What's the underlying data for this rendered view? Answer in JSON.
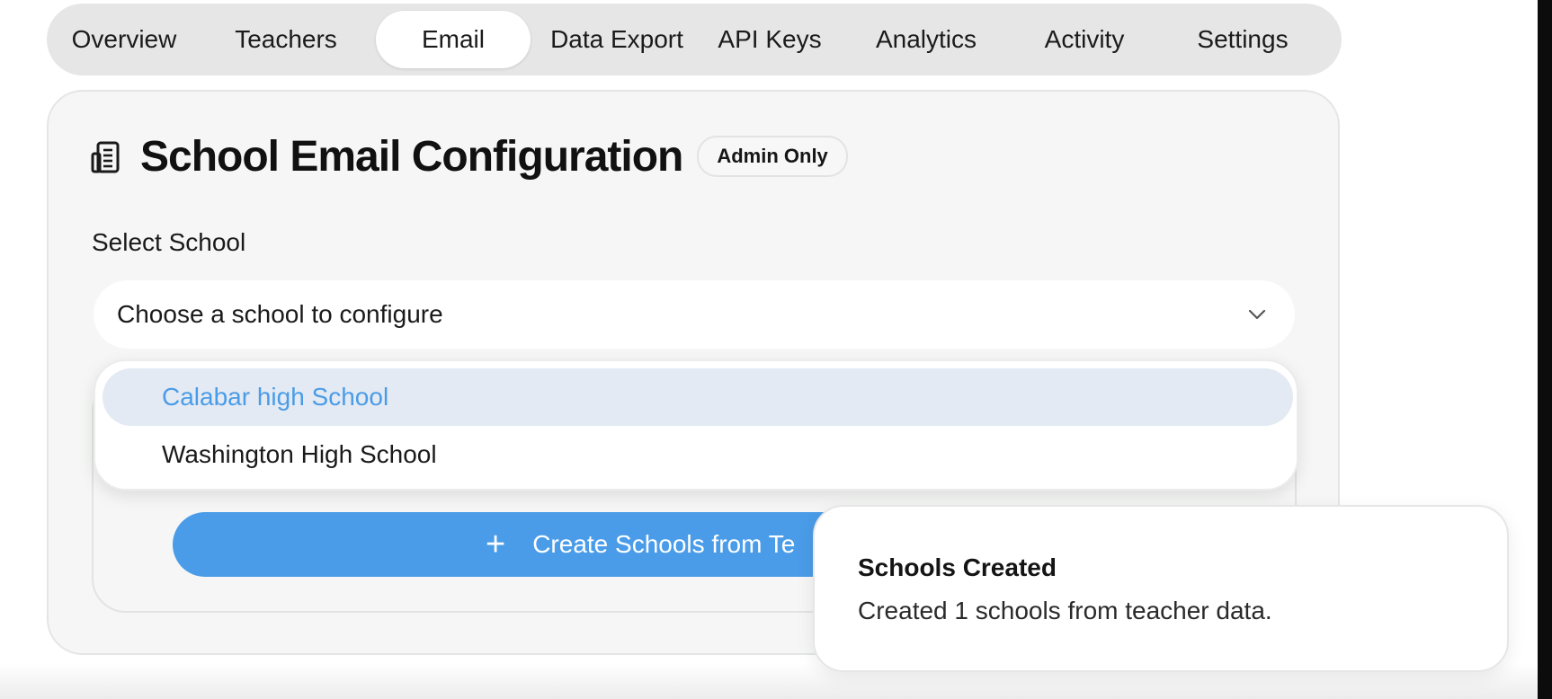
{
  "tabs": [
    {
      "label": "Overview"
    },
    {
      "label": "Teachers"
    },
    {
      "label": "Email"
    },
    {
      "label": "Data Export"
    },
    {
      "label": "API Keys"
    },
    {
      "label": "Analytics"
    },
    {
      "label": "Activity"
    },
    {
      "label": "Settings"
    }
  ],
  "active_tab": "Email",
  "card": {
    "title": "School Email Configuration",
    "badge": "Admin Only",
    "icon": "building-icon"
  },
  "school_select": {
    "label": "Select School",
    "placeholder": "Choose a school to configure",
    "options": [
      "Calabar high School",
      "Washington High School"
    ],
    "highlighted_option": "Calabar high School"
  },
  "create_button": {
    "label": "Create Schools from Te",
    "icon": "plus-icon"
  },
  "toast": {
    "title": "Schools Created",
    "message": "Created 1 schools from teacher data."
  },
  "colors": {
    "accent": "#4a9ce8",
    "highlight_bg": "#e4eaf3",
    "tab_bar_bg": "#e6e6e6",
    "card_bg": "#f5f6f5"
  }
}
